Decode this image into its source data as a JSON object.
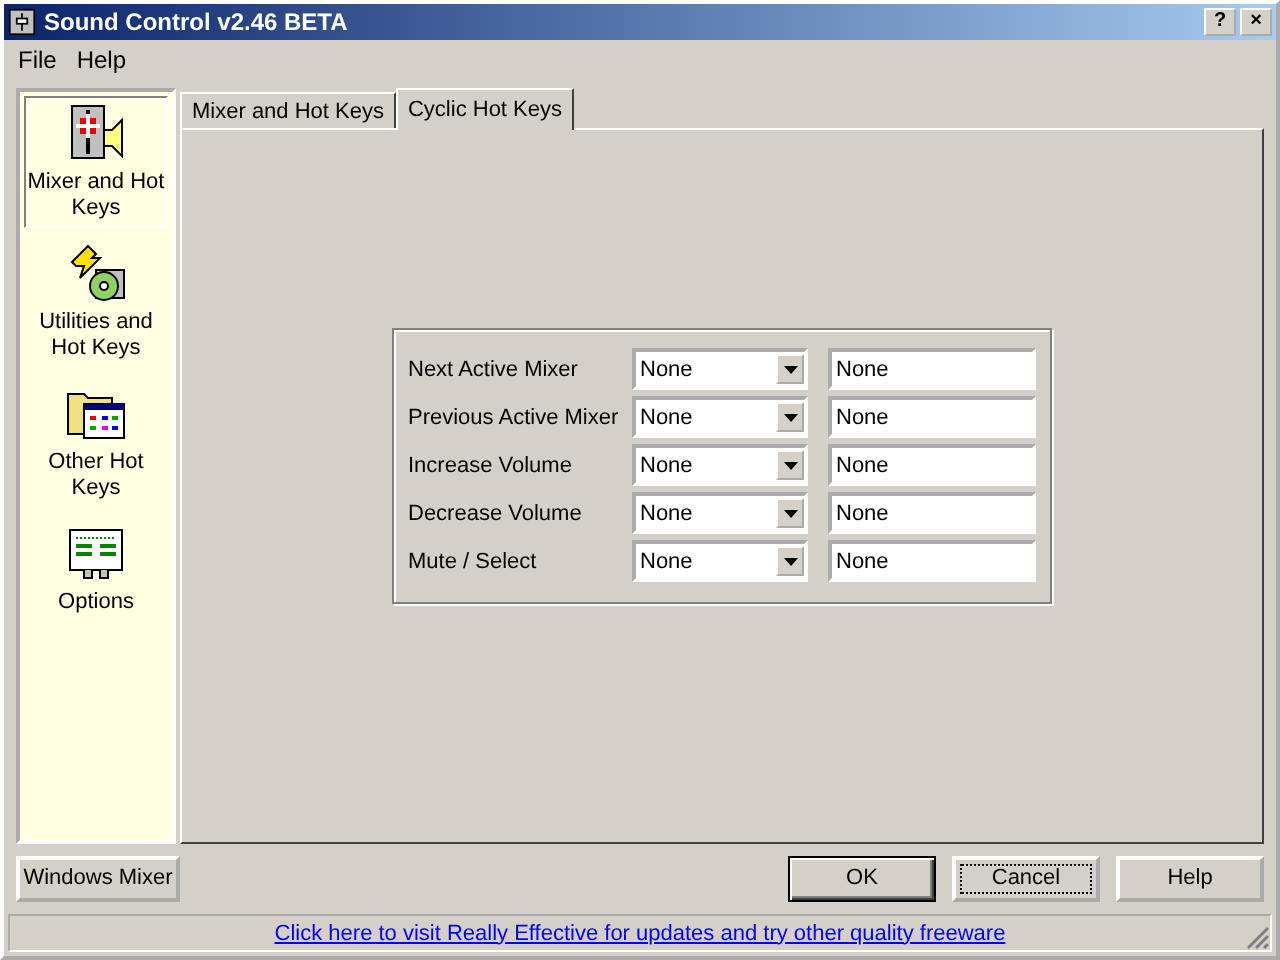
{
  "window": {
    "title": "Sound Control v2.46 BETA",
    "controls": [
      "?",
      "×"
    ]
  },
  "menu": [
    "File",
    "Help"
  ],
  "sidebar": {
    "items": [
      {
        "label": "Mixer and Hot Keys",
        "kind": "mixer",
        "selected": true
      },
      {
        "label": "Utilities and Hot Keys",
        "kind": "utilities",
        "selected": false
      },
      {
        "label": "Other Hot Keys",
        "kind": "other",
        "selected": false
      },
      {
        "label": "Options",
        "kind": "options",
        "selected": false
      }
    ]
  },
  "tabs": [
    {
      "label": "Mixer and Hot Keys",
      "selected": false
    },
    {
      "label": "Cyclic Hot Keys",
      "selected": true
    }
  ],
  "hotkeys": [
    {
      "label": "Next Active Mixer",
      "combo": "None",
      "key": "None"
    },
    {
      "label": "Previous Active Mixer",
      "combo": "None",
      "key": "None"
    },
    {
      "label": "Increase Volume",
      "combo": "None",
      "key": "None"
    },
    {
      "label": "Decrease Volume",
      "combo": "None",
      "key": "None"
    },
    {
      "label": "Mute / Select",
      "combo": "None",
      "key": "None"
    }
  ],
  "buttons": {
    "left": "Windows Mixer",
    "right": [
      {
        "label": "OK",
        "default": true,
        "focused": false
      },
      {
        "label": "Cancel",
        "default": false,
        "focused": true
      },
      {
        "label": "Help",
        "default": false,
        "focused": false
      }
    ]
  },
  "status_bar": {
    "link": "Click here to visit Really Effective for updates and try other quality freeware"
  }
}
